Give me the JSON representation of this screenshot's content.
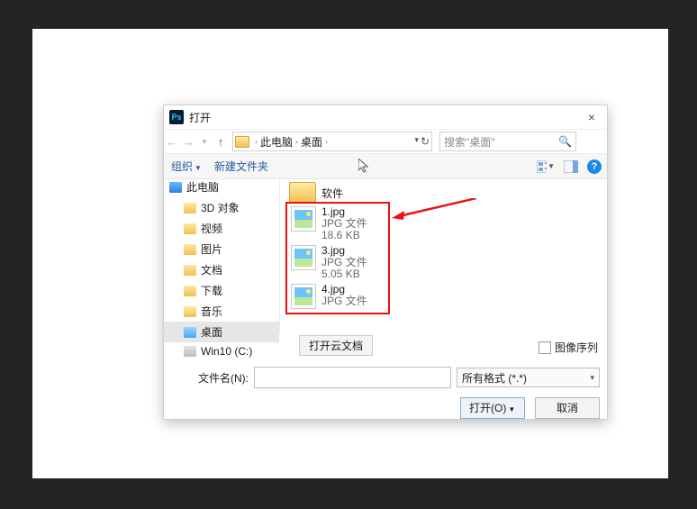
{
  "dialog": {
    "title": "打开",
    "close": "×"
  },
  "nav": {
    "back": "←",
    "forward": "→",
    "up": "↑",
    "crumbs": [
      "此电脑",
      "桌面"
    ],
    "sep": "›",
    "dropdown": "▾",
    "refresh": "↻",
    "search_placeholder": "搜索\"桌面\""
  },
  "toolbar": {
    "organize": "组织",
    "newfolder": "新建文件夹",
    "help": "?"
  },
  "sidebar": {
    "items": [
      {
        "label": "此电脑",
        "icon": "pc",
        "indent": false
      },
      {
        "label": "3D 对象",
        "icon": "3d",
        "indent": true
      },
      {
        "label": "视频",
        "icon": "yellow",
        "indent": true
      },
      {
        "label": "图片",
        "icon": "yellow",
        "indent": true
      },
      {
        "label": "文档",
        "icon": "yellow",
        "indent": true
      },
      {
        "label": "下载",
        "icon": "yellow",
        "indent": true
      },
      {
        "label": "音乐",
        "icon": "yellow",
        "indent": true
      },
      {
        "label": "桌面",
        "icon": "blue",
        "indent": true,
        "selected": true
      },
      {
        "label": "Win10 (C:)",
        "icon": "drive",
        "indent": true
      }
    ]
  },
  "files": {
    "folder": "软件",
    "list": [
      {
        "name": "1.jpg",
        "type": "JPG 文件",
        "size": "18.6 KB"
      },
      {
        "name": "3.jpg",
        "type": "JPG 文件",
        "size": "5.05 KB"
      },
      {
        "name": "4.jpg",
        "type": "JPG 文件",
        "size": ""
      }
    ]
  },
  "bottom": {
    "cloud_btn": "打开云文档",
    "image_sequence": "图像序列",
    "filename_label": "文件名(N):",
    "filename_value": "",
    "filter": "所有格式 (*.*)",
    "open_btn": "打开(O)",
    "cancel_btn": "取消"
  }
}
